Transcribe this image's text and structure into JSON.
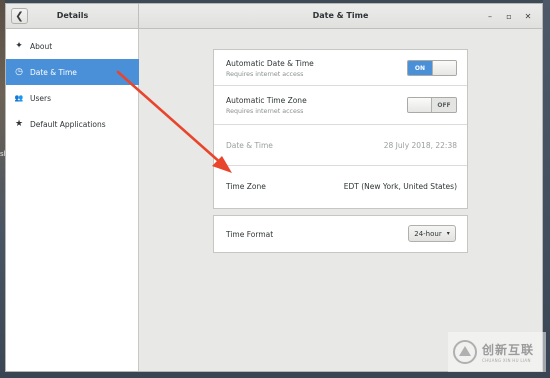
{
  "desktop": {
    "edge_label": "sh"
  },
  "header": {
    "left_title": "Details",
    "main_title": "Date & Time",
    "back_glyph": "❮",
    "minimize_glyph": "–",
    "maximize_glyph": "▫",
    "close_glyph": "✕"
  },
  "sidebar": {
    "items": [
      {
        "label": "About",
        "icon": "star-plus-icon",
        "glyph": "✦",
        "active": false
      },
      {
        "label": "Date & Time",
        "icon": "clock-icon",
        "glyph": "◷",
        "active": true
      },
      {
        "label": "Users",
        "icon": "users-icon",
        "glyph": "👥",
        "active": false
      },
      {
        "label": "Default Applications",
        "icon": "star-icon",
        "glyph": "★",
        "active": false
      }
    ]
  },
  "settings": {
    "auto_datetime": {
      "title": "Automatic Date & Time",
      "subtitle": "Requires internet access",
      "state_label": "ON",
      "enabled": true
    },
    "auto_timezone": {
      "title": "Automatic Time Zone",
      "subtitle": "Requires internet access",
      "state_label": "OFF",
      "enabled": false
    },
    "date_time": {
      "title": "Date & Time",
      "value": "28 July 2018, 22:38"
    },
    "time_zone": {
      "title": "Time Zone",
      "value": "EDT (New York, United States)"
    },
    "time_format": {
      "title": "Time Format",
      "value": "24-hour",
      "caret": "▾"
    }
  },
  "colors": {
    "accent": "#4a90d9",
    "annotation_arrow": "#e8452c"
  },
  "watermark": {
    "cn": "创新互联",
    "en": "CHUANG XIN HU LIAN"
  }
}
